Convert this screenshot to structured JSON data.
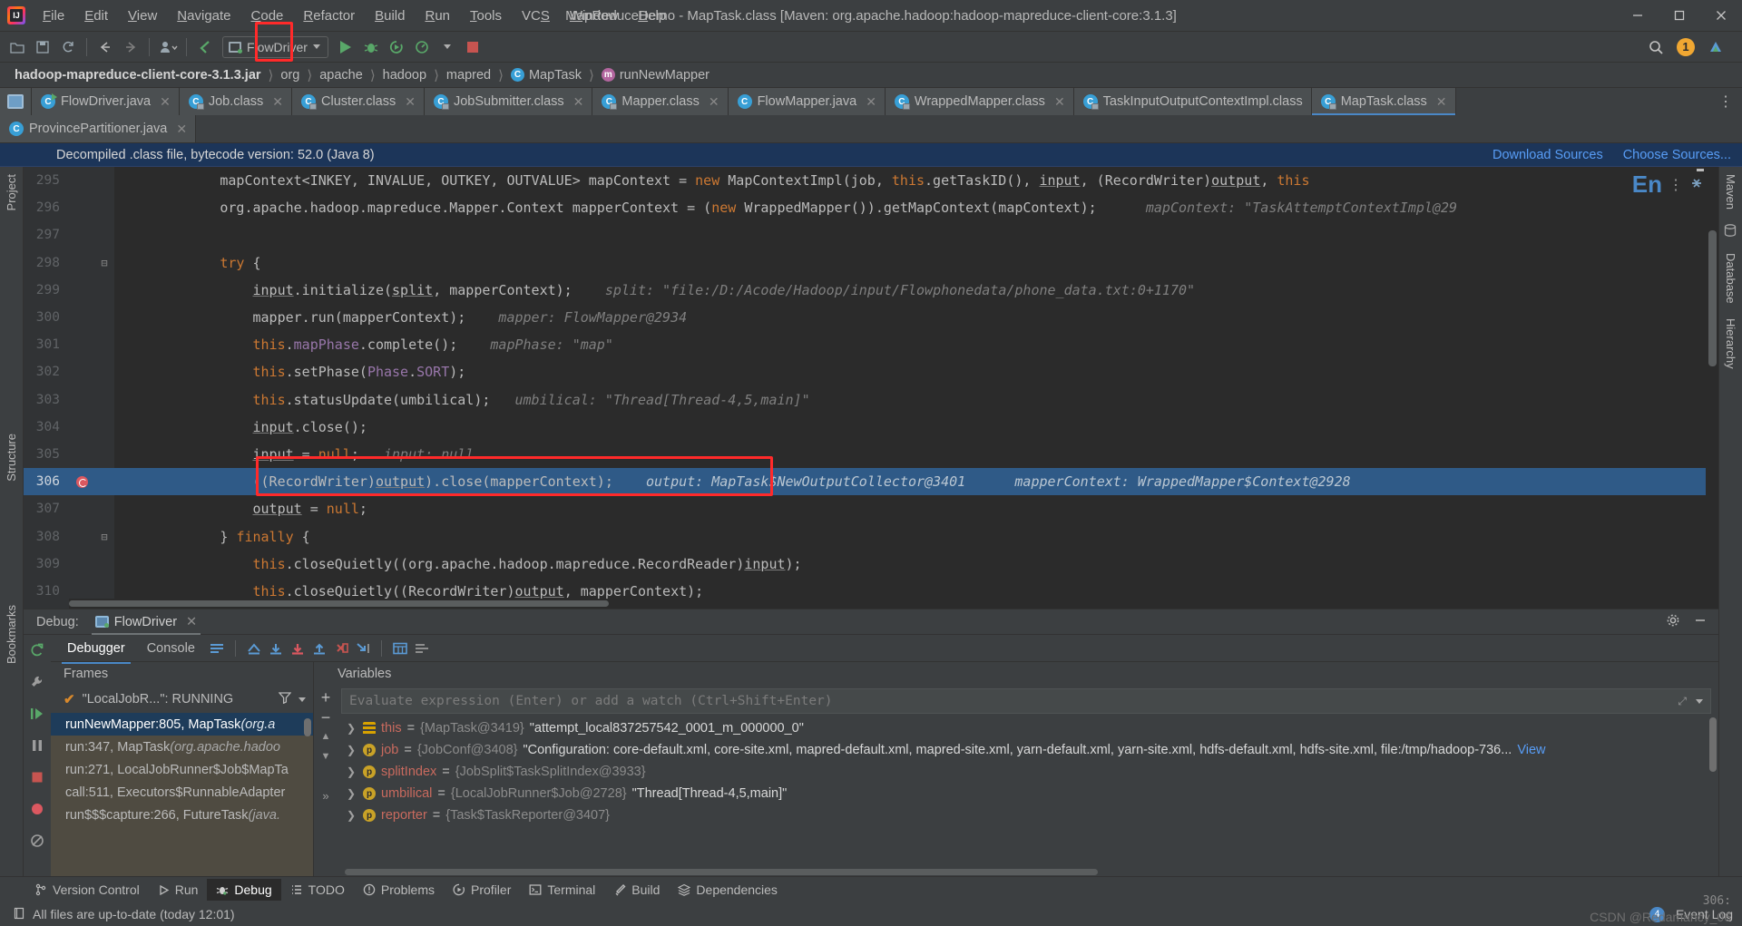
{
  "window": {
    "title": "MapReduceDemo - MapTask.class [Maven: org.apache.hadoop:hadoop-mapreduce-client-core:3.1.3]",
    "minimize": "—",
    "maximize": "▢",
    "close": "✕"
  },
  "menu": {
    "items": [
      {
        "label": "File",
        "mnemonic": "F"
      },
      {
        "label": "Edit",
        "mnemonic": "E"
      },
      {
        "label": "View",
        "mnemonic": "V"
      },
      {
        "label": "Navigate",
        "mnemonic": "N"
      },
      {
        "label": "Code",
        "mnemonic": "C"
      },
      {
        "label": "Refactor",
        "mnemonic": "R"
      },
      {
        "label": "Build",
        "mnemonic": "B"
      },
      {
        "label": "Run",
        "mnemonic": "R"
      },
      {
        "label": "Tools",
        "mnemonic": "T"
      },
      {
        "label": "VCS",
        "mnemonic": "S"
      },
      {
        "label": "Window",
        "mnemonic": "W"
      },
      {
        "label": "Help",
        "mnemonic": "H"
      }
    ]
  },
  "toolbar": {
    "run_config": "FlowDriver",
    "search_icon": "search-icon",
    "update_badge": "1"
  },
  "breadcrumb": {
    "items": [
      {
        "label": "hadoop-mapreduce-client-core-3.1.3.jar",
        "icon": null,
        "bold": true
      },
      {
        "label": "org",
        "icon": null,
        "bold": false
      },
      {
        "label": "apache",
        "icon": null,
        "bold": false
      },
      {
        "label": "hadoop",
        "icon": null,
        "bold": false
      },
      {
        "label": "mapred",
        "icon": null,
        "bold": false
      },
      {
        "label": "MapTask",
        "icon": "c",
        "bold": false
      },
      {
        "label": "runNewMapper",
        "icon": "m",
        "bold": false
      }
    ]
  },
  "tabs": {
    "row1": [
      {
        "label": "FlowDriver.java",
        "kind": "java-run",
        "active": false,
        "closable": true
      },
      {
        "label": "Job.class",
        "kind": "class",
        "active": false,
        "closable": true
      },
      {
        "label": "Cluster.class",
        "kind": "class",
        "active": false,
        "closable": true
      },
      {
        "label": "JobSubmitter.class",
        "kind": "class",
        "active": false,
        "closable": true
      },
      {
        "label": "Mapper.class",
        "kind": "class",
        "active": false,
        "closable": true
      },
      {
        "label": "FlowMapper.java",
        "kind": "java",
        "active": false,
        "closable": true
      },
      {
        "label": "WrappedMapper.class",
        "kind": "class",
        "active": false,
        "closable": true
      },
      {
        "label": "TaskInputOutputContextImpl.class",
        "kind": "class",
        "active": false,
        "closable": false
      },
      {
        "label": "MapTask.class",
        "kind": "class",
        "active": true,
        "closable": true
      }
    ],
    "row2": [
      {
        "label": "ProvincePartitioner.java",
        "kind": "java",
        "active": false,
        "closable": true
      }
    ],
    "overflow_icon": "more-options-icon"
  },
  "notification": {
    "text": "Decompiled .class file, bytecode version: 52.0 (Java 8)",
    "link_download": "Download Sources",
    "link_choose": "Choose Sources..."
  },
  "left_bar": {
    "project_label": "Project",
    "structure_label": "Structure",
    "bookmarks_label": "Bookmarks"
  },
  "right_bar": {
    "maven_label": "Maven",
    "database_label": "Database",
    "hierarchy_label": "Hierarchy"
  },
  "editor": {
    "language_indicator": "En",
    "lines": [
      {
        "num": "295",
        "fold": "",
        "sel": false,
        "bp": false,
        "clipped": true,
        "html": "            mapContext<INKEY, INVALUE, OUTKEY, OUTVALUE> mapContext = new MapContextImpl(job, this.getTaskID(), input, (RecordWriter)output, this"
      },
      {
        "num": "296",
        "fold": "",
        "sel": false,
        "bp": false,
        "html": "            org.apache.hadoop.mapreduce.Mapper.Context mapperContext = (new WrappedMapper()).getMapContext(mapContext);      mapContext: \"TaskAttemptContextImpl@29"
      },
      {
        "num": "297",
        "fold": "",
        "sel": false,
        "bp": false,
        "html": ""
      },
      {
        "num": "298",
        "fold": "-",
        "sel": false,
        "bp": false,
        "html": "            try {"
      },
      {
        "num": "299",
        "fold": "",
        "sel": false,
        "bp": false,
        "html": "                input.initialize(split, mapperContext);    split: \"file:/D:/Acode/Hadoop/input/Flowphonedata/phone_data.txt:0+1170\""
      },
      {
        "num": "300",
        "fold": "",
        "sel": false,
        "bp": false,
        "html": "                mapper.run(mapperContext);    mapper: FlowMapper@2934"
      },
      {
        "num": "301",
        "fold": "",
        "sel": false,
        "bp": false,
        "html": "                this.mapPhase.complete();    mapPhase: \"map\""
      },
      {
        "num": "302",
        "fold": "",
        "sel": false,
        "bp": false,
        "html": "                this.setPhase(Phase.SORT);"
      },
      {
        "num": "303",
        "fold": "",
        "sel": false,
        "bp": false,
        "html": "                this.statusUpdate(umbilical);   umbilical: \"Thread[Thread-4,5,main]\""
      },
      {
        "num": "304",
        "fold": "",
        "sel": false,
        "bp": false,
        "html": "                input.close();"
      },
      {
        "num": "305",
        "fold": "",
        "sel": false,
        "bp": false,
        "html": "                input = null;   input: null"
      },
      {
        "num": "306",
        "fold": "",
        "sel": true,
        "bp": true,
        "html": "                ((RecordWriter)output).close(mapperContext);    output: MapTask$NewOutputCollector@3401      mapperContext: WrappedMapper$Context@2928"
      },
      {
        "num": "307",
        "fold": "",
        "sel": false,
        "bp": false,
        "html": "                output = null;"
      },
      {
        "num": "308",
        "fold": "-",
        "sel": false,
        "bp": false,
        "html": "            } finally {"
      },
      {
        "num": "309",
        "fold": "",
        "sel": false,
        "bp": false,
        "html": "                this.closeQuietly((org.apache.hadoop.mapreduce.RecordReader)input);"
      },
      {
        "num": "310",
        "fold": "",
        "sel": false,
        "bp": false,
        "html": "                this.closeQuietly((RecordWriter)output, mapperContext);"
      },
      {
        "num": "311",
        "fold": "-",
        "sel": false,
        "bp": false,
        "html": "            }"
      }
    ],
    "highlighted_line": "306"
  },
  "debug": {
    "header_label": "Debug:",
    "session_name": "FlowDriver",
    "close_icon": "close-icon",
    "settings_icon": "gear-icon",
    "minimize_icon": "minimize-icon",
    "tabs": [
      {
        "label": "Debugger",
        "active": true
      },
      {
        "label": "Console",
        "active": false
      }
    ],
    "tool_icons": [
      "show-execution-point-icon",
      "step-over-icon",
      "step-into-icon",
      "force-step-into-icon",
      "step-out-icon",
      "drop-frame-icon",
      "run-to-cursor-icon",
      "evaluate-expression-icon",
      "settings-list-icon"
    ],
    "highlighted_tool": "step-into-icon",
    "frames": {
      "title": "Frames",
      "thread": "\"LocalJobR...\": RUNNING",
      "filter_icon": "filter-icon",
      "dropdown_icon": "chevron-down-icon",
      "items": [
        {
          "method": "runNewMapper:805, MapTask ",
          "pkg": "(org.a",
          "selected": true
        },
        {
          "method": "run:347, MapTask ",
          "pkg": "(org.apache.hadoo",
          "selected": false
        },
        {
          "method": "run:271, LocalJobRunner$Job$MapTa",
          "pkg": "",
          "selected": false
        },
        {
          "method": "call:511, Executors$RunnableAdapter",
          "pkg": "",
          "selected": false
        },
        {
          "method": "run$$$capture:266, FutureTask ",
          "pkg": "(java.",
          "selected": false
        }
      ]
    },
    "variables": {
      "title": "Variables",
      "add_icon": "plus-icon",
      "remove_icon": "minus-icon",
      "up_icon": "chevron-up-icon",
      "down_icon": "chevron-down-icon",
      "evaluate_placeholder": "Evaluate expression (Enter) or add a watch (Ctrl+Shift+Enter)",
      "rows": [
        {
          "icon": "this",
          "name": "this",
          "ref": "{MapTask@3419}",
          "value": "\"attempt_local837257542_0001_m_000000_0\"",
          "link": ""
        },
        {
          "icon": "p",
          "name": "job",
          "ref": "{JobConf@3408}",
          "value": "\"Configuration: core-default.xml, core-site.xml, mapred-default.xml, mapred-site.xml, yarn-default.xml, yarn-site.xml, hdfs-default.xml, hdfs-site.xml, file:/tmp/hadoop-736...",
          "link": "View"
        },
        {
          "icon": "p",
          "name": "splitIndex",
          "ref": "{JobSplit$TaskSplitIndex@3933}",
          "value": "",
          "link": ""
        },
        {
          "icon": "p",
          "name": "umbilical",
          "ref": "{LocalJobRunner$Job@2728}",
          "value": "\"Thread[Thread-4,5,main]\"",
          "link": ""
        },
        {
          "icon": "p",
          "name": "reporter",
          "ref": "{Task$TaskReporter@3407}",
          "value": "",
          "link": ""
        }
      ]
    }
  },
  "bottom_tools": [
    {
      "label": "Version Control",
      "icon": "branch-icon",
      "active": false
    },
    {
      "label": "Run",
      "icon": "play-icon",
      "active": false
    },
    {
      "label": "Debug",
      "icon": "bug-icon",
      "active": true
    },
    {
      "label": "TODO",
      "icon": "list-icon",
      "active": false
    },
    {
      "label": "Problems",
      "icon": "warning-icon",
      "active": false
    },
    {
      "label": "Profiler",
      "icon": "profiler-icon",
      "active": false
    },
    {
      "label": "Terminal",
      "icon": "terminal-icon",
      "active": false
    },
    {
      "label": "Build",
      "icon": "hammer-icon",
      "active": false
    },
    {
      "label": "Dependencies",
      "icon": "layers-icon",
      "active": false
    }
  ],
  "statusbar": {
    "message": "All files are up-to-date (today 12:01)",
    "event_log": "Event Log",
    "event_count": "4",
    "caret_position": "306:",
    "watermark": "CSDN @Redamancy_06"
  },
  "colors": {
    "accent": "#4a88c7",
    "selection": "#2f5a87",
    "highlight_box": "#ff2a2a",
    "panel_bg": "#3c3f41",
    "editor_bg": "#2b2b2b",
    "notification_bg": "#1c3559",
    "keyword": "#cc7832",
    "string": "#6a8759",
    "field": "#9876aa",
    "comment": "#808080"
  }
}
